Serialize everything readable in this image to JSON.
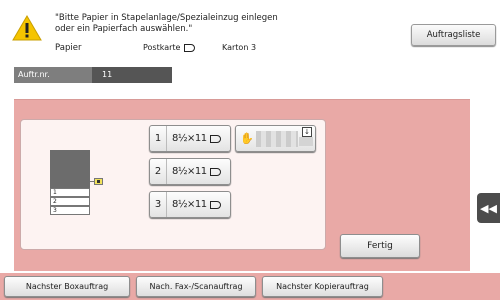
{
  "message": {
    "line1": "\"Bitte Papier in Stapelanlage/Spezialeinzug einlegen",
    "line2": "oder ein Papierfach auswählen.\""
  },
  "paper": {
    "label": "Papier",
    "option1": "Postkarte",
    "option2": "Karton 3"
  },
  "header": {
    "job_list_label": "Auftragsliste"
  },
  "job": {
    "label": "Auftr.nr.",
    "value": "11"
  },
  "trays": [
    {
      "number": "1",
      "size": "8½×11"
    },
    {
      "number": "2",
      "size": "8½×11"
    },
    {
      "number": "3",
      "size": "8½×11"
    }
  ],
  "machine_trays": [
    "1",
    "2",
    "3"
  ],
  "done_label": "Fertig",
  "side_tab_glyph": "◀◀",
  "bottom": {
    "next_box": "Nachster Boxauftrag",
    "next_fax": "Nach. Fax-/Scanauftrag",
    "next_copy": "Nachster Kopierauftrag"
  },
  "colors": {
    "panel": "#e9a9a6",
    "warning": "#f5c400",
    "bypass": "#f2e25a"
  }
}
